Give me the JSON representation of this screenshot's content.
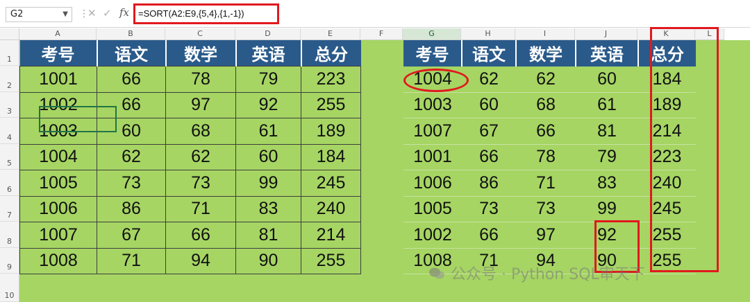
{
  "namebox": {
    "value": "G2"
  },
  "formula_bar": {
    "fx_label": "fx",
    "formula": "=SORT(A2:E9,{5,4},{1,-1})"
  },
  "columns": [
    "A",
    "B",
    "C",
    "D",
    "E",
    "F",
    "G",
    "H",
    "I",
    "J",
    "K",
    "L"
  ],
  "selected_column": "G",
  "rows": [
    "1",
    "2",
    "3",
    "4",
    "5",
    "6",
    "7",
    "8",
    "9",
    "10"
  ],
  "left_table": {
    "headers": [
      "考号",
      "语文",
      "数学",
      "英语",
      "总分"
    ],
    "rows": [
      [
        "1001",
        "66",
        "78",
        "79",
        "223"
      ],
      [
        "1002",
        "66",
        "97",
        "92",
        "255"
      ],
      [
        "1003",
        "60",
        "68",
        "61",
        "189"
      ],
      [
        "1004",
        "62",
        "62",
        "60",
        "184"
      ],
      [
        "1005",
        "73",
        "73",
        "99",
        "245"
      ],
      [
        "1006",
        "86",
        "71",
        "83",
        "240"
      ],
      [
        "1007",
        "67",
        "66",
        "81",
        "214"
      ],
      [
        "1008",
        "71",
        "94",
        "90",
        "255"
      ]
    ]
  },
  "right_table": {
    "headers": [
      "考号",
      "语文",
      "数学",
      "英语",
      "总分"
    ],
    "rows": [
      [
        "1004",
        "62",
        "62",
        "60",
        "184"
      ],
      [
        "1003",
        "60",
        "68",
        "61",
        "189"
      ],
      [
        "1007",
        "67",
        "66",
        "81",
        "214"
      ],
      [
        "1001",
        "66",
        "78",
        "79",
        "223"
      ],
      [
        "1006",
        "86",
        "71",
        "83",
        "240"
      ],
      [
        "1005",
        "73",
        "73",
        "99",
        "245"
      ],
      [
        "1002",
        "66",
        "97",
        "92",
        "255"
      ],
      [
        "1008",
        "71",
        "94",
        "90",
        "255"
      ]
    ]
  },
  "watermark": {
    "text": "公众号 · Python SQL审天下"
  },
  "colors": {
    "header_fill": "#2a5a8a",
    "sheet_fill": "#a6d563",
    "highlight": "#e0191e"
  }
}
